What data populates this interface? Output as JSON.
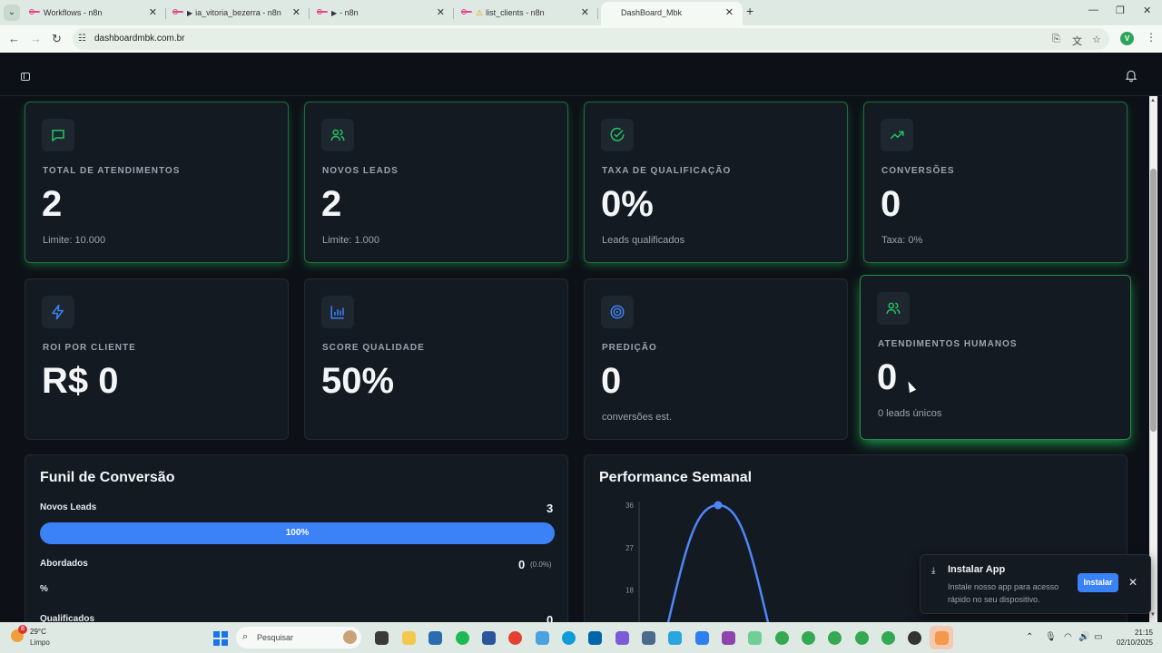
{
  "browser": {
    "tabs": [
      {
        "title": "Workflows - n8n",
        "icon": "n8n-logo-icon"
      },
      {
        "title": "ia_vitoria_bezerra - n8n",
        "icon": "n8n-logo-icon"
      },
      {
        "title": "- n8n",
        "icon": "n8n-logo-icon"
      },
      {
        "title": "list_clients - n8n",
        "icon": "n8n-logo-icon"
      },
      {
        "title": "DashBoard_Mbk",
        "icon": "none"
      }
    ],
    "url": "dashboardmbk.com.br",
    "profile_initial": "V"
  },
  "stats_row1": [
    {
      "label": "TOTAL DE ATENDIMENTOS",
      "value": "2",
      "sub": "Limite: 10.000",
      "icon": "message-square-icon"
    },
    {
      "label": "NOVOS LEADS",
      "value": "2",
      "sub": "Limite: 1.000",
      "icon": "users-icon"
    },
    {
      "label": "TAXA DE QUALIFICAÇÃO",
      "value": "0%",
      "sub": "Leads qualificados",
      "icon": "check-circle-icon"
    },
    {
      "label": "CONVERSÕES",
      "value": "0",
      "sub": "Taxa: 0%",
      "icon": "trending-up-icon"
    }
  ],
  "stats_row2": [
    {
      "label": "ROI POR CLIENTE",
      "value": "R$ 0",
      "sub": "",
      "icon": "zap-icon"
    },
    {
      "label": "SCORE QUALIDADE",
      "value": "50%",
      "sub": "",
      "icon": "bar-chart-icon"
    },
    {
      "label": "PREDIÇÃO",
      "value": "0",
      "sub": "conversões est.",
      "icon": "target-icon"
    },
    {
      "label": "ATENDIMENTOS HUMANOS",
      "value": "0",
      "sub": "0 leads únicos",
      "icon": "users-icon"
    }
  ],
  "funnel": {
    "title": "Funil de Conversão",
    "stages": [
      {
        "label": "Novos Leads",
        "value": "3",
        "bar_label": "100%",
        "fill": 1.0
      },
      {
        "label": "Abordados",
        "value": "0",
        "pct": "(0.0%)",
        "extra": "%"
      },
      {
        "label": "Qualificados",
        "value": "0"
      }
    ]
  },
  "performance": {
    "title": "Performance Semanal",
    "colors": {
      "line": "#4f86f7"
    }
  },
  "chart_data": {
    "type": "line",
    "title": "Performance Semanal",
    "yticks": [
      "36",
      "27",
      "18"
    ],
    "ylim": [
      0,
      36
    ],
    "series": [
      {
        "values": [
          0,
          36,
          0
        ]
      }
    ],
    "grid": false
  },
  "toast": {
    "title": "Instalar App",
    "desc": "Instale nosso app para acesso rápido no seu dispositivo.",
    "button": "Instalar"
  },
  "taskbar": {
    "temp": "29°C",
    "weather": "Limpo",
    "weather_badge": "8",
    "search_placeholder": "Pesquisar",
    "time": "21:15",
    "date": "02/10/2025"
  },
  "colors": {
    "accent": "#3b82f6",
    "green": "#22c55e",
    "bg": "#0d1117",
    "card": "#141a22"
  }
}
